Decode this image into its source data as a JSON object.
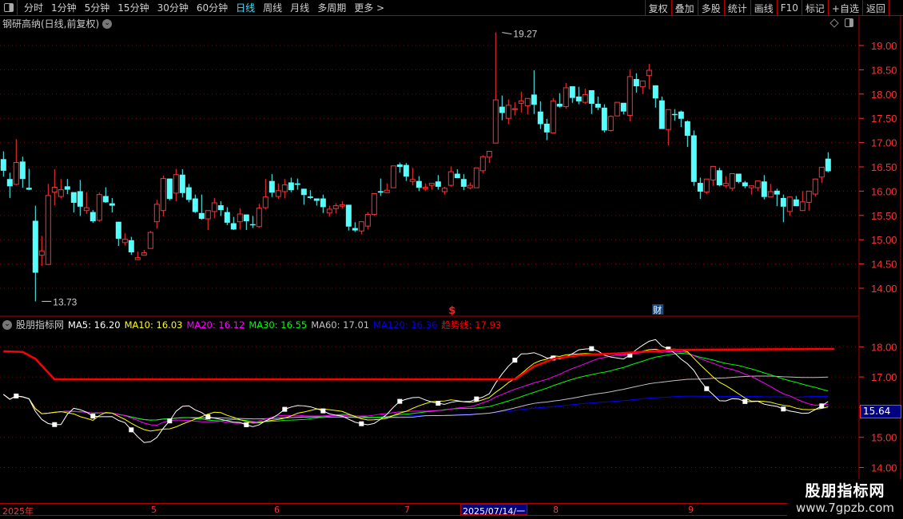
{
  "toolbar": {
    "periods": [
      "分时",
      "1分钟",
      "5分钟",
      "15分钟",
      "30分钟",
      "60分钟",
      "日线",
      "周线",
      "月线",
      "多周期",
      "更多 >"
    ],
    "active_period": "日线",
    "buttons": [
      "复权",
      "叠加",
      "多股",
      "统计",
      "画线",
      "F10",
      "标记",
      "+自选",
      "返回"
    ]
  },
  "title": {
    "stock": "钢研高纳(日线,前复权)"
  },
  "colors": {
    "up": "#ff3232",
    "down": "#54ffff",
    "grid": "#8b0000",
    "axis": "#ff3030",
    "ma5": "#ffffff",
    "ma10": "#ffff00",
    "ma20": "#ff00ff",
    "ma30": "#00ff00",
    "ma60": "#c0c0c0",
    "ma120": "#0000ff",
    "trend": "#ff0000"
  },
  "chart_data": {
    "type": "candlestick",
    "price_axis": {
      "ticks": [
        "19.00",
        "18.50",
        "18.00",
        "17.50",
        "17.00",
        "16.50",
        "16.00",
        "15.50",
        "15.00",
        "14.50",
        "14.00"
      ],
      "range": [
        13.6,
        19.35
      ]
    },
    "high_label": "19.27",
    "low_label": "13.73",
    "high_index": 78,
    "low_index": 6,
    "candles": [
      [
        16.66,
        16.82,
        16.3,
        16.42
      ],
      [
        16.25,
        16.38,
        15.86,
        16.1
      ],
      [
        16.14,
        17.07,
        16.12,
        16.59
      ],
      [
        16.61,
        16.71,
        16.07,
        16.25
      ],
      [
        16.07,
        16.46,
        16.02,
        16.03
      ],
      [
        15.39,
        15.7,
        13.73,
        14.32
      ],
      [
        14.68,
        15.08,
        14.46,
        14.77
      ],
      [
        14.49,
        16.15,
        14.49,
        15.91
      ],
      [
        15.98,
        16.45,
        15.71,
        16.08
      ],
      [
        15.89,
        16.25,
        15.85,
        16.03
      ],
      [
        16.1,
        16.25,
        15.94,
        16.03
      ],
      [
        15.98,
        15.98,
        15.56,
        15.76
      ],
      [
        16.0,
        16.23,
        15.49,
        15.68
      ],
      [
        15.6,
        15.98,
        15.53,
        15.66
      ],
      [
        15.57,
        15.61,
        15.35,
        15.38
      ],
      [
        15.4,
        15.97,
        15.37,
        15.93
      ],
      [
        15.9,
        16.08,
        15.76,
        15.77
      ],
      [
        15.75,
        15.86,
        15.56,
        15.7
      ],
      [
        15.37,
        15.37,
        14.87,
        15.02
      ],
      [
        14.94,
        15.13,
        14.88,
        15.01
      ],
      [
        14.99,
        15.06,
        14.69,
        14.74
      ],
      [
        14.59,
        14.76,
        14.59,
        14.63
      ],
      [
        14.68,
        14.79,
        14.68,
        14.73
      ],
      [
        14.82,
        15.18,
        14.82,
        15.15
      ],
      [
        15.37,
        15.82,
        15.23,
        15.73
      ],
      [
        15.6,
        16.32,
        15.48,
        16.26
      ],
      [
        16.26,
        16.26,
        15.81,
        15.84
      ],
      [
        15.96,
        16.46,
        15.79,
        16.34
      ],
      [
        16.34,
        16.45,
        15.87,
        15.96
      ],
      [
        16.08,
        16.15,
        15.77,
        15.82
      ],
      [
        15.85,
        15.93,
        15.55,
        15.57
      ],
      [
        15.55,
        15.93,
        15.41,
        15.43
      ],
      [
        15.43,
        15.6,
        15.2,
        15.6
      ],
      [
        15.58,
        15.86,
        15.45,
        15.76
      ],
      [
        15.71,
        15.79,
        15.49,
        15.61
      ],
      [
        15.57,
        15.67,
        15.3,
        15.35
      ],
      [
        15.34,
        15.47,
        15.2,
        15.21
      ],
      [
        15.37,
        15.65,
        15.21,
        15.53
      ],
      [
        15.52,
        15.52,
        15.2,
        15.38
      ],
      [
        15.32,
        15.49,
        15.24,
        15.3
      ],
      [
        15.27,
        15.74,
        15.25,
        15.65
      ],
      [
        15.66,
        16.25,
        15.62,
        15.88
      ],
      [
        16.21,
        16.35,
        15.88,
        15.97
      ],
      [
        15.89,
        16.16,
        15.84,
        16.01
      ],
      [
        15.99,
        16.25,
        15.85,
        16.13
      ],
      [
        16.18,
        16.28,
        15.98,
        16.02
      ],
      [
        16.16,
        16.26,
        16.03,
        16.13
      ],
      [
        16.05,
        16.05,
        15.72,
        15.92
      ],
      [
        15.89,
        16.02,
        15.84,
        15.86
      ],
      [
        15.85,
        15.85,
        15.7,
        15.8
      ],
      [
        15.85,
        15.93,
        15.55,
        15.67
      ],
      [
        15.55,
        15.7,
        15.48,
        15.63
      ],
      [
        15.64,
        15.75,
        15.54,
        15.7
      ],
      [
        15.69,
        15.79,
        15.64,
        15.72
      ],
      [
        15.72,
        15.72,
        15.19,
        15.27
      ],
      [
        15.24,
        15.36,
        15.16,
        15.19
      ],
      [
        15.18,
        15.37,
        15.11,
        15.37
      ],
      [
        15.28,
        15.57,
        15.21,
        15.52
      ],
      [
        15.52,
        15.95,
        15.49,
        15.95
      ],
      [
        16.0,
        16.26,
        15.9,
        15.97
      ],
      [
        15.97,
        16.16,
        15.97,
        16.02
      ],
      [
        16.07,
        16.52,
        16.07,
        16.52
      ],
      [
        16.55,
        16.59,
        16.38,
        16.5
      ],
      [
        16.54,
        16.58,
        16.21,
        16.3
      ],
      [
        16.2,
        16.48,
        16.12,
        16.24
      ],
      [
        16.21,
        16.31,
        16.0,
        16.07
      ],
      [
        16.05,
        16.16,
        16.0,
        16.08
      ],
      [
        16.12,
        16.16,
        16.03,
        16.16
      ],
      [
        16.2,
        16.33,
        16.03,
        16.09
      ],
      [
        15.99,
        16.09,
        15.93,
        16.06
      ],
      [
        16.12,
        16.51,
        16.09,
        16.4
      ],
      [
        16.36,
        16.45,
        16.27,
        16.27
      ],
      [
        16.25,
        16.35,
        16.02,
        16.09
      ],
      [
        16.07,
        16.18,
        16.04,
        16.12
      ],
      [
        16.07,
        16.48,
        16.07,
        16.48
      ],
      [
        16.42,
        16.74,
        16.37,
        16.71
      ],
      [
        16.7,
        16.82,
        16.58,
        16.82
      ],
      [
        16.99,
        19.27,
        16.99,
        17.88
      ],
      [
        17.74,
        17.97,
        17.46,
        17.61
      ],
      [
        17.5,
        17.89,
        17.38,
        17.77
      ],
      [
        17.68,
        17.83,
        17.56,
        17.7
      ],
      [
        17.81,
        18.05,
        17.62,
        17.86
      ],
      [
        17.76,
        17.91,
        17.58,
        17.91
      ],
      [
        17.99,
        18.49,
        17.59,
        17.78
      ],
      [
        17.64,
        17.85,
        17.28,
        17.38
      ],
      [
        17.39,
        17.49,
        17.05,
        17.21
      ],
      [
        17.2,
        17.92,
        17.2,
        17.86
      ],
      [
        17.8,
        18.02,
        17.72,
        17.74
      ],
      [
        17.74,
        18.23,
        17.7,
        18.13
      ],
      [
        18.16,
        18.16,
        17.82,
        17.92
      ],
      [
        17.95,
        18.15,
        17.79,
        17.85
      ],
      [
        17.83,
        18.11,
        17.8,
        17.99
      ],
      [
        18.08,
        18.08,
        17.59,
        17.8
      ],
      [
        17.8,
        17.95,
        17.67,
        17.72
      ],
      [
        17.72,
        17.79,
        17.21,
        17.25
      ],
      [
        17.25,
        17.56,
        17.23,
        17.54
      ],
      [
        17.55,
        17.83,
        17.55,
        17.83
      ],
      [
        17.82,
        17.82,
        17.58,
        17.64
      ],
      [
        17.56,
        18.51,
        17.44,
        18.36
      ],
      [
        18.31,
        18.43,
        18.03,
        18.16
      ],
      [
        18.15,
        18.27,
        18.0,
        18.27
      ],
      [
        18.38,
        18.62,
        18.1,
        18.49
      ],
      [
        18.18,
        18.18,
        17.72,
        17.91
      ],
      [
        17.87,
        17.95,
        17.28,
        17.28
      ],
      [
        17.27,
        17.68,
        16.94,
        17.68
      ],
      [
        17.59,
        17.69,
        17.45,
        17.59
      ],
      [
        17.64,
        17.66,
        17.32,
        17.49
      ],
      [
        17.44,
        17.46,
        16.91,
        17.14
      ],
      [
        17.15,
        17.25,
        16.11,
        16.19
      ],
      [
        16.17,
        16.28,
        15.84,
        15.99
      ],
      [
        15.98,
        16.25,
        15.94,
        16.25
      ],
      [
        16.23,
        16.51,
        16.11,
        16.51
      ],
      [
        16.43,
        16.48,
        16.1,
        16.12
      ],
      [
        16.11,
        16.31,
        16.07,
        16.16
      ],
      [
        16.06,
        16.36,
        16.01,
        16.36
      ],
      [
        16.36,
        16.36,
        16.16,
        16.19
      ],
      [
        16.18,
        16.21,
        16.06,
        16.1
      ],
      [
        16.07,
        16.11,
        15.93,
        16.11
      ],
      [
        16.07,
        16.21,
        16.0,
        16.21
      ],
      [
        16.2,
        16.33,
        15.83,
        15.88
      ],
      [
        15.88,
        16.15,
        15.88,
        15.99
      ],
      [
        16.01,
        16.05,
        15.69,
        15.93
      ],
      [
        15.86,
        15.93,
        15.36,
        15.68
      ],
      [
        15.58,
        15.88,
        15.49,
        15.88
      ],
      [
        15.83,
        15.9,
        15.69,
        15.69
      ],
      [
        15.6,
        16.0,
        15.6,
        15.78
      ],
      [
        15.77,
        16.0,
        15.6,
        16.0
      ],
      [
        15.94,
        16.26,
        15.89,
        16.25
      ],
      [
        16.29,
        16.49,
        16.17,
        16.49
      ],
      [
        16.67,
        16.8,
        16.39,
        16.41
      ]
    ],
    "event_markers": [
      {
        "index": 70,
        "label": "$"
      },
      {
        "index": 102,
        "label": "财"
      }
    ],
    "indicator": {
      "name": "股朋指标网",
      "legend": [
        {
          "key": "ma5",
          "label": "MA5: 16.20",
          "period": 5
        },
        {
          "key": "ma10",
          "label": "MA10: 16.03",
          "period": 10
        },
        {
          "key": "ma20",
          "label": "MA20: 16.12",
          "period": 20
        },
        {
          "key": "ma30",
          "label": "MA30: 16.55",
          "period": 30
        },
        {
          "key": "ma60",
          "label": "MA60: 17.01",
          "period": 60
        },
        {
          "key": "ma120",
          "label": "MA120: 16.36",
          "period": 120
        },
        {
          "key": "trend",
          "label": "趋势线: 17.93"
        }
      ],
      "axis_ticks": [
        "18.00",
        "17.00",
        "15.00",
        "14.00"
      ],
      "axis_values": [
        18,
        17,
        15,
        14
      ],
      "range": [
        13.7,
        18.9
      ],
      "current_value": "15.64",
      "trend_breakpoints": [
        [
          0,
          17.85
        ],
        [
          3,
          17.83
        ],
        [
          5,
          17.6
        ],
        [
          8,
          16.92
        ],
        [
          80,
          16.92
        ],
        [
          83,
          17.35
        ],
        [
          86,
          17.6
        ],
        [
          90,
          17.72
        ],
        [
          96,
          17.78
        ],
        [
          105,
          17.9
        ],
        [
          130,
          17.93
        ]
      ]
    }
  },
  "date_axis": {
    "labels": [
      "2025年",
      "5",
      "6",
      "7",
      "8",
      "9"
    ],
    "selected": "2025/07/14/一"
  },
  "watermark": {
    "title": "股朋指标网",
    "url": "www.7gpzb.com"
  }
}
